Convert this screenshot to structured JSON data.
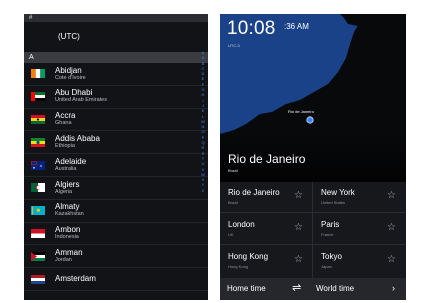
{
  "list_panel": {
    "hash_header": "#",
    "utc_label": "(UTC)",
    "section_label": "A",
    "cities": [
      {
        "name": "Abidjan",
        "country": "Cote d'Ivoire",
        "flag": "ivory-coast-flag-icon"
      },
      {
        "name": "Abu Dhabi",
        "country": "United Arab Emirates",
        "flag": "uae-flag-icon"
      },
      {
        "name": "Accra",
        "country": "Ghana",
        "flag": "ghana-flag-icon"
      },
      {
        "name": "Addis Ababa",
        "country": "Ethiopia",
        "flag": "ethiopia-flag-icon"
      },
      {
        "name": "Adelaide",
        "country": "Australia",
        "flag": "australia-flag-icon"
      },
      {
        "name": "Algiers",
        "country": "Algeria",
        "flag": "algeria-flag-icon"
      },
      {
        "name": "Almaty",
        "country": "Kazakhstan",
        "flag": "kazakhstan-flag-icon"
      },
      {
        "name": "Ambon",
        "country": "Indonesia",
        "flag": "indonesia-flag-icon"
      },
      {
        "name": "Amman",
        "country": "Jordan",
        "flag": "jordan-flag-icon"
      },
      {
        "name": "Amsterdam",
        "country": "",
        "flag": "netherlands-flag-icon"
      }
    ],
    "index_letters": [
      "#",
      "A",
      "B",
      "C",
      "D",
      "E",
      "F",
      "G",
      "H",
      "I",
      "J",
      "K",
      "L",
      "M",
      "N",
      "O",
      "P",
      "Q",
      "R",
      "S",
      "T",
      "U",
      "V",
      "W",
      "X",
      "Y",
      "Z"
    ]
  },
  "clock_panel": {
    "time_main": "10:08",
    "time_seconds": ":36 AM",
    "tz_label": "UTC-3",
    "pin_label": "Rio de Janeiro",
    "current_city": "Rio de Janeiro",
    "current_country": "Brazil",
    "grid": [
      {
        "name": "Rio de Janeiro",
        "country": "Brazil"
      },
      {
        "name": "New York",
        "country": "United States"
      },
      {
        "name": "London",
        "country": "UK"
      },
      {
        "name": "Paris",
        "country": "France"
      },
      {
        "name": "Hong Kong",
        "country": "Hong Kong"
      },
      {
        "name": "Tokyo",
        "country": "Japan"
      }
    ],
    "star_glyph": "☆",
    "bottom": {
      "home_label": "Home time",
      "swap_glyph": "⇌",
      "world_label": "World time",
      "arrow_glyph": "›"
    }
  },
  "colors": {
    "ocean": "#163c7f",
    "land": "#08090b",
    "pin": "#3d86ff"
  }
}
